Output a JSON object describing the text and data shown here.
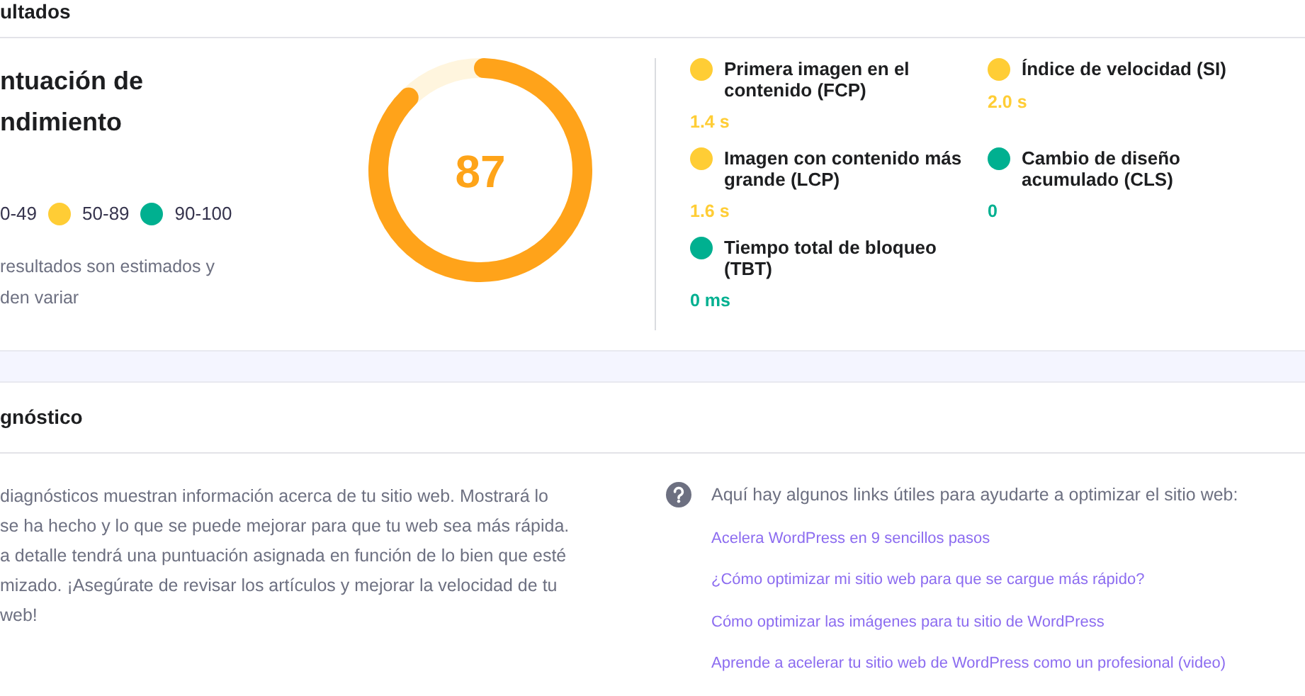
{
  "results": {
    "title": "ultados",
    "score_title": "ntuación de ndimiento",
    "legend": [
      {
        "label": "0-49"
      },
      {
        "label": "50-89",
        "color": "#ffcd35"
      },
      {
        "label": "90-100",
        "color": "#00b090"
      }
    ],
    "note": "resultados son estimados y den variar",
    "score": {
      "value": "87",
      "level": 0.87
    },
    "metrics": [
      {
        "name": "Primera imagen en el contenido (FCP)",
        "value": "1.4 s",
        "color": "#ffcd35"
      },
      {
        "name": "Índice de velocidad (SI)",
        "value": "2.0 s",
        "color": "#ffcd35"
      },
      {
        "name": "Imagen con contenido más grande (LCP)",
        "value": "1.6 s",
        "color": "#ffcd35"
      },
      {
        "name": "Cambio de diseño acumulado (CLS)",
        "value": "0",
        "color": "#00b090"
      },
      {
        "name": "Tiempo total de bloqueo (TBT)",
        "value": "0 ms",
        "color": "#00b090"
      }
    ]
  },
  "diagnostics": {
    "title": "gnóstico",
    "lines": [
      "diagnósticos muestran información acerca de tu sitio web. Mostrará lo",
      "se ha hecho y lo que se puede mejorar para que tu web sea más rápida.",
      "a detalle tendrá una puntuación asignada en función de lo bien que esté",
      "mizado. ¡Asegúrate de revisar los artículos y mejorar la velocidad de tu",
      "web!"
    ],
    "help_text": "Aquí hay algunos links útiles para ayudarte a optimizar el sitio web:",
    "links": [
      "Acelera WordPress en 9 sencillos pasos",
      "¿Cómo optimizar mi sitio web para que se cargue más rápido?",
      "Cómo optimizar las imágenes para tu sitio de WordPress",
      "Aprende a acelerar tu sitio web de WordPress como un profesional (video)"
    ]
  }
}
